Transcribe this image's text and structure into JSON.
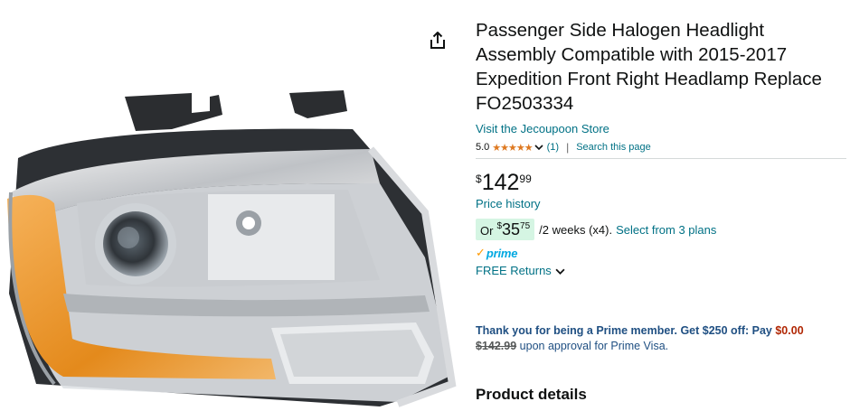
{
  "product": {
    "title_lines": [
      "Passenger Side Halogen Headlight",
      "Assembly Compatible with 2015-2017",
      "Expedition Front Right Headlamp Replace",
      "FO2503334"
    ],
    "store_link": "Visit the Jecoupoon Store",
    "rating": "5.0",
    "stars": "★★★★★",
    "rating_count": "(1)",
    "search_page": "Search this page",
    "price": {
      "currency": "$",
      "whole": "142",
      "fraction": "99"
    },
    "price_history": "Price history",
    "installment": {
      "prefix": "Or",
      "currency": "$",
      "whole": "35",
      "fraction": "75",
      "terms": "/2 weeks (x4).",
      "plans_link": "Select from 3 plans"
    },
    "prime_label": "prime",
    "returns": "FREE Returns",
    "prime_offer": {
      "line1": "Thank you for being a Prime member. Get $250 off: Pay",
      "new_price": "$0.00",
      "old_price": "$142.99",
      "line2": "upon approval for Prime Visa."
    },
    "section_heading": "Product details"
  },
  "icons": {
    "share": "share-icon",
    "chevron": "chevron-down-icon",
    "prime_check": "prime-check-icon"
  },
  "colors": {
    "link": "#007185",
    "star": "#de7921",
    "installment_bg": "#d5f5e3",
    "prime_blue": "#00a8e1",
    "prime_orange": "#ff9900",
    "offer_red": "#b12704"
  }
}
